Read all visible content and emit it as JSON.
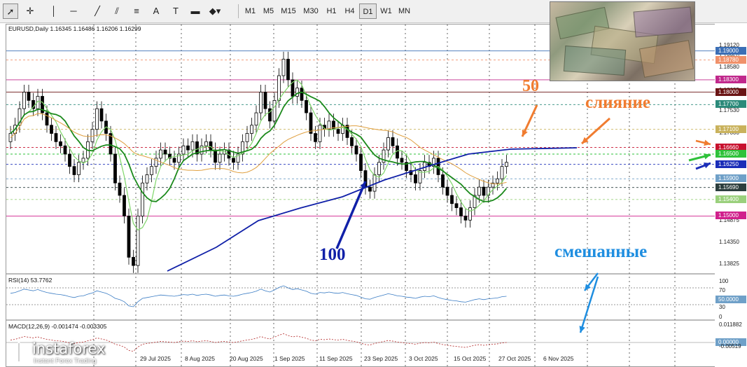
{
  "toolbar": {
    "tools": [
      {
        "name": "cursor-icon",
        "glyph": "➚"
      },
      {
        "name": "crosshair-icon",
        "glyph": "✛"
      },
      {
        "name": "vertical-line-icon",
        "glyph": "│"
      },
      {
        "name": "horizontal-line-icon",
        "glyph": "─"
      },
      {
        "name": "trendline-icon",
        "glyph": "╱"
      },
      {
        "name": "channel-icon",
        "glyph": "⫽"
      },
      {
        "name": "fibonacci-icon",
        "glyph": "≡"
      },
      {
        "name": "text-icon",
        "glyph": "A"
      },
      {
        "name": "text-label-icon",
        "glyph": "T"
      },
      {
        "name": "rectangle-icon",
        "glyph": "▬"
      },
      {
        "name": "shapes-icon",
        "glyph": "◆▾"
      }
    ],
    "timeframes": [
      "M1",
      "M5",
      "M15",
      "M30",
      "H1",
      "H4",
      "D1",
      "W1",
      "MN"
    ],
    "active_timeframe": "D1"
  },
  "chart": {
    "symbol_line": "EURUSD,Daily  1.16345 1.16486 1.16206 1.16299",
    "rsi_label": "RSI(14) 53.7762",
    "macd_label": "MACD(12,26,9) -0.001474 -0.003305",
    "price_labels": [
      "1.19120",
      "1.18850",
      "1.18580",
      "1.18035",
      "1.17530",
      "1.17000",
      "1.14875",
      "1.14350",
      "1.13825"
    ],
    "level_tags": [
      {
        "value": "1.19000",
        "color": "#3b6fb6"
      },
      {
        "value": "1.18780",
        "color": "#f0916a"
      },
      {
        "value": "1.18300",
        "color": "#c0288c"
      },
      {
        "value": "1.18000",
        "color": "#6b1414"
      },
      {
        "value": "1.17700",
        "color": "#2b8a7a"
      },
      {
        "value": "1.17100",
        "color": "#c9b25c"
      },
      {
        "value": "1.16660",
        "color": "#c8102e"
      },
      {
        "value": "1.16500",
        "color": "#2ec23a"
      },
      {
        "value": "1.16250",
        "color": "#1a2db8"
      },
      {
        "value": "1.15900",
        "color": "#6fa0c8"
      },
      {
        "value": "1.15690",
        "color": "#2c3e3e"
      },
      {
        "value": "1.15400",
        "color": "#9ad07c"
      },
      {
        "value": "1.15000",
        "color": "#d0208c"
      }
    ],
    "rsi_axis": [
      "100",
      "70",
      "50.0000",
      "30",
      "0"
    ],
    "macd_axis": [
      "0.011882",
      "0.00000",
      "-0.00519"
    ],
    "dates": [
      "29 Jul 2025",
      "8 Aug 2025",
      "20 Aug 2025",
      "1 Sep 2025",
      "11 Sep 2025",
      "23 Sep 2025",
      "3 Oct 2025",
      "15 Oct 2025",
      "27 Oct 2025",
      "6 Nov 2025"
    ]
  },
  "annotations": {
    "ma50": "50",
    "ma100": "100",
    "merge": "слияние",
    "mixed": "смешанные"
  },
  "branding": {
    "logo": "instaforex",
    "tagline": "Instant Forex Trading"
  },
  "colors": {
    "ma_fast": "#7fd66a",
    "ma_mid": "#1c8a1c",
    "ma50": "#e0a040",
    "ma100": "#1020a8",
    "annotation_orange": "#f07c30",
    "annotation_blue": "#1f8ee0"
  }
}
